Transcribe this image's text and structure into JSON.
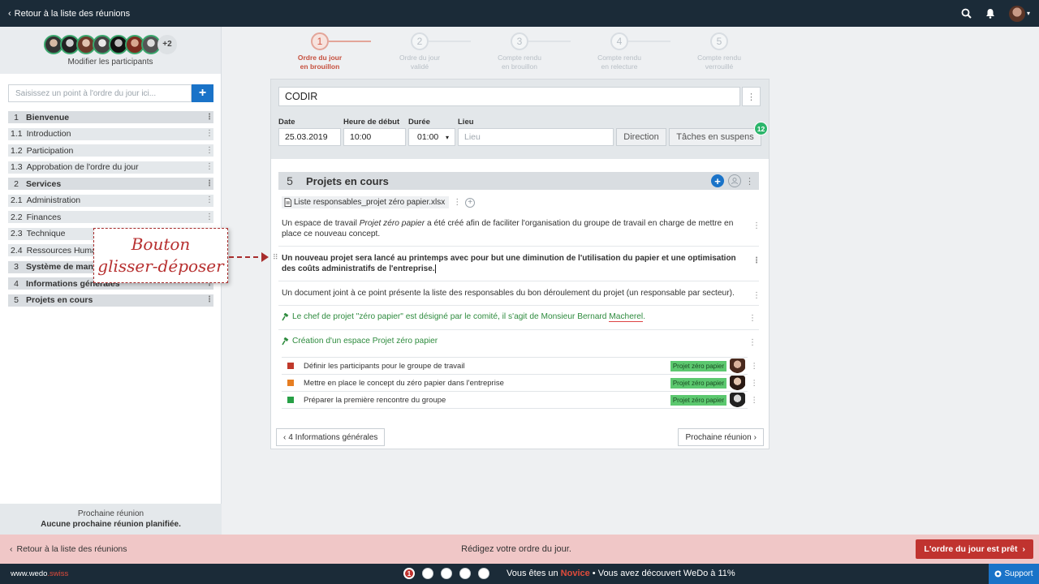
{
  "topbar": {
    "back_label": "Retour à la liste des réunions"
  },
  "sidebar": {
    "participants_more": "+2",
    "modify_label": "Modifier les participants",
    "search_placeholder": "Saisissez un point à l'ordre du jour ici...",
    "items": [
      {
        "num": "1",
        "label": "Bienvenue",
        "section": true
      },
      {
        "num": "1.1",
        "label": "Introduction",
        "section": false
      },
      {
        "num": "1.2",
        "label": "Participation",
        "section": false
      },
      {
        "num": "1.3",
        "label": "Approbation de l'ordre du jour",
        "section": false
      },
      {
        "num": "2",
        "label": "Services",
        "section": true
      },
      {
        "num": "2.1",
        "label": "Administration",
        "section": false
      },
      {
        "num": "2.2",
        "label": "Finances",
        "section": false
      },
      {
        "num": "2.3",
        "label": "Technique",
        "section": false
      },
      {
        "num": "2.4",
        "label": "Ressources Humaines",
        "section": false
      },
      {
        "num": "3",
        "label": "Système de management",
        "section": true
      },
      {
        "num": "4",
        "label": "Informations générales",
        "section": true
      },
      {
        "num": "5",
        "label": "Projets en cours",
        "section": true
      }
    ],
    "footer_title": "Prochaine réunion",
    "footer_value": "Aucune prochaine réunion planifiée."
  },
  "annotation": {
    "line1": "Bouton",
    "line2": "glisser-déposer"
  },
  "stepper": [
    {
      "num": "1",
      "line1": "Ordre du jour",
      "line2": "en brouillon",
      "active": true
    },
    {
      "num": "2",
      "line1": "Ordre du jour",
      "line2": "validé",
      "active": false
    },
    {
      "num": "3",
      "line1": "Compte rendu",
      "line2": "en brouillon",
      "active": false
    },
    {
      "num": "4",
      "line1": "Compte rendu",
      "line2": "en relecture",
      "active": false
    },
    {
      "num": "5",
      "line1": "Compte rendu",
      "line2": "verrouillé",
      "active": false
    }
  ],
  "meeting": {
    "title": "CODIR",
    "date_label": "Date",
    "date_value": "25.03.2019",
    "start_label": "Heure de début",
    "start_value": "10:00",
    "duration_label": "Durée",
    "duration_value": "01:00",
    "place_label": "Lieu",
    "place_placeholder": "Lieu",
    "direction_button": "Direction",
    "pending_button": "Tâches en suspens",
    "pending_count": "12"
  },
  "section": {
    "num": "5",
    "title": "Projets en cours",
    "attachment": "Liste responsables_projet zéro papier.xlsx",
    "para1_a": "Un espace de travail ",
    "para1_em": "Projet zéro papier",
    "para1_b": " a été créé afin de faciliter l'organisation du groupe de travail en charge de mettre en place ce nouveau concept.",
    "para2": "Un nouveau projet sera lancé au printemps avec pour but une diminution de l'utilisation du papier et une optimisation des coûts administratifs de l'entreprise.",
    "para3": "Un document joint à ce point présente la liste des responsables du bon déroulement du projet (un responsable par secteur).",
    "decision1_a": "Le chef de projet \"zéro papier\" est désigné par le comité, il s'agit de Monsieur Bernard ",
    "decision1_b": "Macherel",
    "decision1_c": ".",
    "decision2": "Création d'un espace Projet zéro papier",
    "tasks": [
      {
        "label": "Définir les participants pour le groupe de travail",
        "tag": "Projet zéro papier",
        "color": "#c0392b"
      },
      {
        "label": "Mettre en place le concept du zéro papier dans l'entreprise",
        "tag": "Projet zéro papier",
        "color": "#e67e22"
      },
      {
        "label": "Préparer la première rencontre du groupe",
        "tag": "Projet zéro papier",
        "color": "#27a046"
      }
    ]
  },
  "nav": {
    "prev": "4 Informations générales",
    "next": "Prochaine réunion"
  },
  "actionbar": {
    "back_label": "Retour à la liste des réunions",
    "message": "Rédigez votre ordre du jour.",
    "ready_button": "L'ordre du jour est prêt"
  },
  "footer": {
    "brand_a": "www.wedo",
    "brand_b": ".swiss",
    "active_dot": "1",
    "novice_a": "Vous êtes un ",
    "novice_b": "Novice",
    "novice_c": " • Vous avez découvert WeDo à 11%",
    "support": "Support"
  }
}
